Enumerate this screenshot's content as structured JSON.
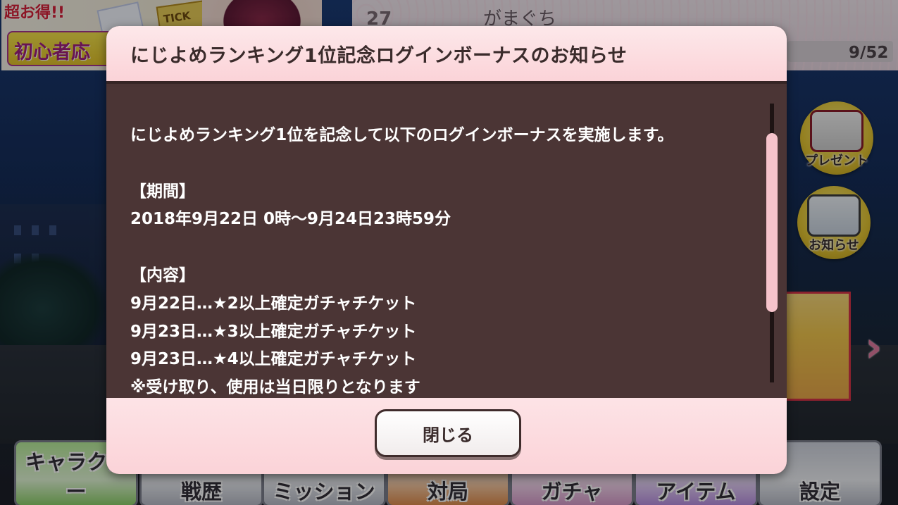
{
  "background": {
    "promo": {
      "top_text": "超お得!!",
      "sub_text": "初心者応",
      "ticket_text": "TICK"
    },
    "header": {
      "rank_number": "27",
      "player_name": "がまぐち",
      "progress_text": "9/52"
    },
    "side_buttons": {
      "present_label": "プレゼント",
      "notice_label": "お知らせ"
    },
    "nav": {
      "items": [
        {
          "label": "キャラクター"
        },
        {
          "label": "戦歴"
        },
        {
          "label": "ミッション"
        },
        {
          "label": "対局"
        },
        {
          "label": "ガチャ"
        },
        {
          "label": "アイテム"
        },
        {
          "label": "設定"
        }
      ]
    },
    "next_arrow": "›"
  },
  "dialog": {
    "title": "にじよめランキング1位記念ログインボーナスのお知らせ",
    "body_lines": [
      "にじよめランキング1位を記念して以下のログインボーナスを実施します。",
      "",
      "【期間】",
      "2018年9月22日 0時〜9月24日23時59分",
      "",
      "【内容】",
      "9月22日…★2以上確定ガチャチケット",
      "9月23日…★3以上確定ガチャチケット",
      "9月23日…★4以上確定ガチャチケット",
      "※受け取り、使用は当日限りとなります"
    ],
    "close_label": "閉じる"
  },
  "colors": {
    "dialog_header_bg": "#fbd3d8",
    "dialog_body_bg": "#4b3535",
    "scroll_thumb": "#f6c3cb",
    "text_dark": "#3a2b2b"
  }
}
